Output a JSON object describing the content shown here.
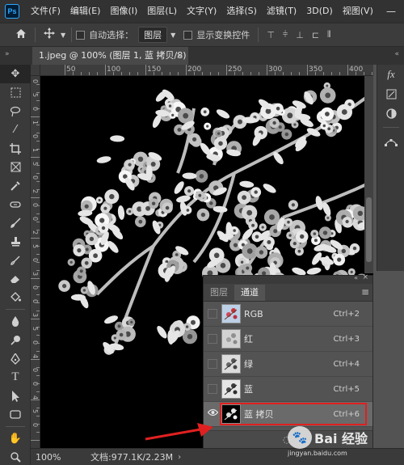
{
  "app": {
    "logo_text": "Ps",
    "menus": [
      "文件(F)",
      "编辑(E)",
      "图像(I)",
      "图层(L)",
      "文字(Y)",
      "选择(S)",
      "滤镜(T)",
      "3D(D)",
      "视图(V)"
    ],
    "window_controls": [
      "—",
      "☐",
      "✕"
    ]
  },
  "options_bar": {
    "home_icon": "home-icon",
    "move_icon": "move-tool-icon",
    "auto_select_label": "自动选择：",
    "auto_select_value": "图层",
    "show_transform_label": "显示变换控件"
  },
  "document": {
    "tab_title": "1.jpeg @ 100% (图层 1, 蓝 拷贝/8) *",
    "tab_close": "×",
    "ruler_ticks_h": [
      "50",
      "100",
      "150",
      "200",
      "250",
      "300",
      "350",
      "400",
      "450"
    ],
    "ruler_ticks_v": [
      "0",
      "5",
      "0",
      "1",
      "0",
      "1",
      "5",
      "0",
      "2",
      "0",
      "0",
      "2",
      "5",
      "0",
      "3",
      "0",
      "0",
      "3",
      "5",
      "0",
      "4",
      "0",
      "0",
      "4",
      "5",
      "0"
    ]
  },
  "status_bar": {
    "zoom": "100%",
    "doc_info": "文档:977.1K/2.23M",
    "arrow": "›"
  },
  "channels_panel": {
    "collapse_arrows": "«",
    "close": "×",
    "tabs": [
      "图层",
      "通道"
    ],
    "active_tab": "通道",
    "menu_icon": "≡",
    "rows": [
      {
        "name": "RGB",
        "shortcut": "Ctrl+2",
        "visible": false,
        "selected": false
      },
      {
        "name": "红",
        "shortcut": "Ctrl+3",
        "visible": false,
        "selected": false
      },
      {
        "name": "绿",
        "shortcut": "Ctrl+4",
        "visible": false,
        "selected": false
      },
      {
        "name": "蓝",
        "shortcut": "Ctrl+5",
        "visible": false,
        "selected": false
      },
      {
        "name": "蓝 拷贝",
        "shortcut": "Ctrl+6",
        "visible": true,
        "selected": true
      }
    ]
  },
  "watermark": {
    "text": "Bai 经验",
    "url": "jingyan.baidu.com"
  },
  "colors": {
    "annotation_red": "#e02020",
    "panel_bg": "#535353",
    "canvas_bg": "#000000"
  }
}
